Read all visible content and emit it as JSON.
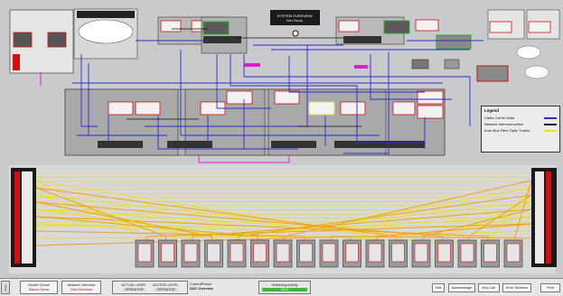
{
  "header": {
    "center_title_line1": "SYSTEM OVERVIEW",
    "center_title_line2": "Main Display"
  },
  "legend": {
    "title": "Legend",
    "items": [
      {
        "label": "Cable Cat 6e Data",
        "color": "#2a2ad6"
      },
      {
        "label": "Network Interconnection",
        "color": "#111111"
      },
      {
        "label": "Auto-Bus Fibre Optic Trunks",
        "color": "#e9dd3a"
      }
    ]
  },
  "bottom": {
    "tab_label": "Views",
    "nav1_top": "Router Ovrvw",
    "nav1_bottom": "Status Ovrvw",
    "nav2_top": "Network Overview",
    "nav2_bottom": "Grid Overview",
    "actual_user_label": "ACTUAL USER",
    "actual_user_value": "OPERATOR",
    "access_level_label": "ACCESS LEVEL",
    "access_level_value": "OPERATOR",
    "current_picture_label": "CurrentPicture",
    "current_picture_value": "SAS Overview",
    "switching_label": "Switching Activity",
    "switching_value": "IDLE",
    "btn1": "Test",
    "btn2": "Acknowledge",
    "btn3": "Key Call",
    "btn4": "Error Sections",
    "btn5": "Print"
  },
  "colors": {
    "data_line": "#2a2ad6",
    "fibre_line": "#e9dd3a",
    "orange_line": "#f0a020",
    "magenta_line": "#e020d0",
    "red_border": "#d01010",
    "green_border": "#20b020"
  }
}
